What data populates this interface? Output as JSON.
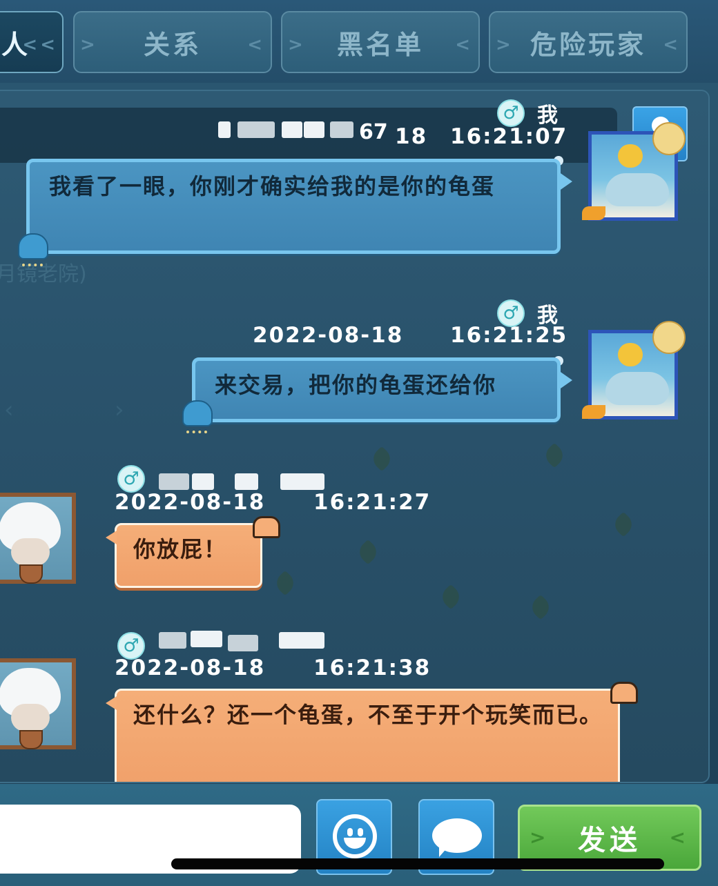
{
  "tabs": [
    {
      "label": "人",
      "active": true
    },
    {
      "label": "关系",
      "active": false
    },
    {
      "label": "黑名单",
      "active": false
    },
    {
      "label": "危险玩家",
      "active": false
    }
  ],
  "icons": {
    "gender": "♂",
    "profile": "user-icon",
    "emoji": "smiley-icon",
    "quick_chat": "speech-bubble-icon"
  },
  "messages": [
    {
      "side": "right",
      "sender": "我",
      "time": "16:21:07",
      "text": "我看了一眼，你刚才确实给我的是你的龟蛋",
      "bubble_color": "#4b95c2"
    },
    {
      "side": "right",
      "sender": "我",
      "date": "2022-08-18",
      "time": "16:21:25",
      "text": "来交易，把你的龟蛋还给你",
      "bubble_color": "#4b95c2"
    },
    {
      "side": "left",
      "sender": "",
      "date": "2022-08-18",
      "time": "16:21:27",
      "text": "你放屁！",
      "bubble_color": "#f5ae78"
    },
    {
      "side": "left",
      "sender": "",
      "date": "2022-08-18",
      "time": "16:21:38",
      "text": "还什么？还一个龟蛋，不至于开个玩笑而已。",
      "bubble_color": "#f5ae78"
    }
  ],
  "msg1_partial": {
    "name_tail": "67",
    "date_tail": "18"
  },
  "background_text": {
    "left_hint": "月镜老院)"
  },
  "input": {
    "value": "",
    "placeholder": ""
  },
  "send_label": "发送"
}
